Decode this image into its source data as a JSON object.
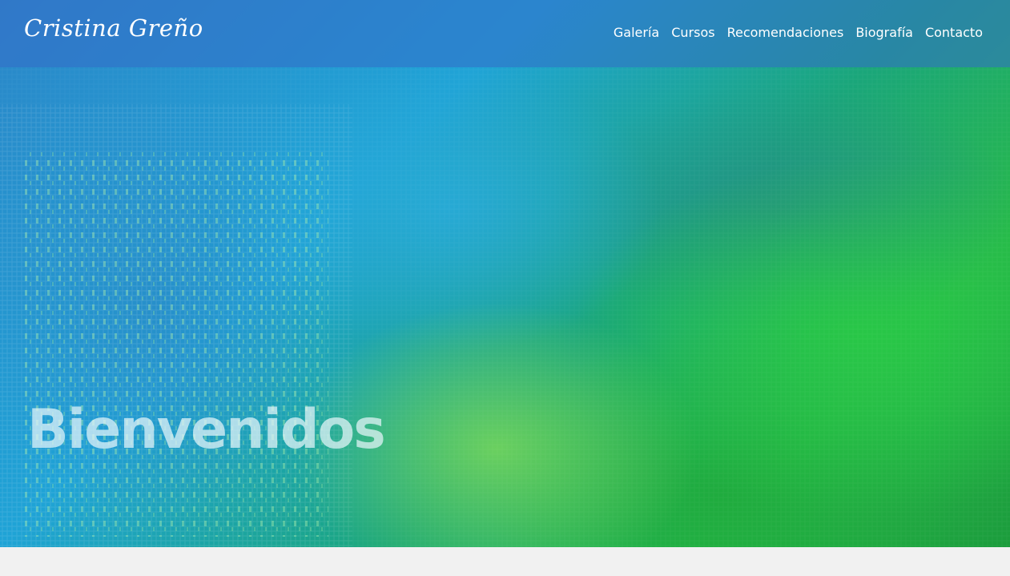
{
  "header": {
    "logo_text": "Cristina Greño",
    "nav": [
      {
        "label": "Galería"
      },
      {
        "label": "Cursos"
      },
      {
        "label": "Recomendaciones"
      },
      {
        "label": "Biografía"
      },
      {
        "label": "Contacto"
      }
    ]
  },
  "hero": {
    "title": "Bienvenidos"
  }
}
